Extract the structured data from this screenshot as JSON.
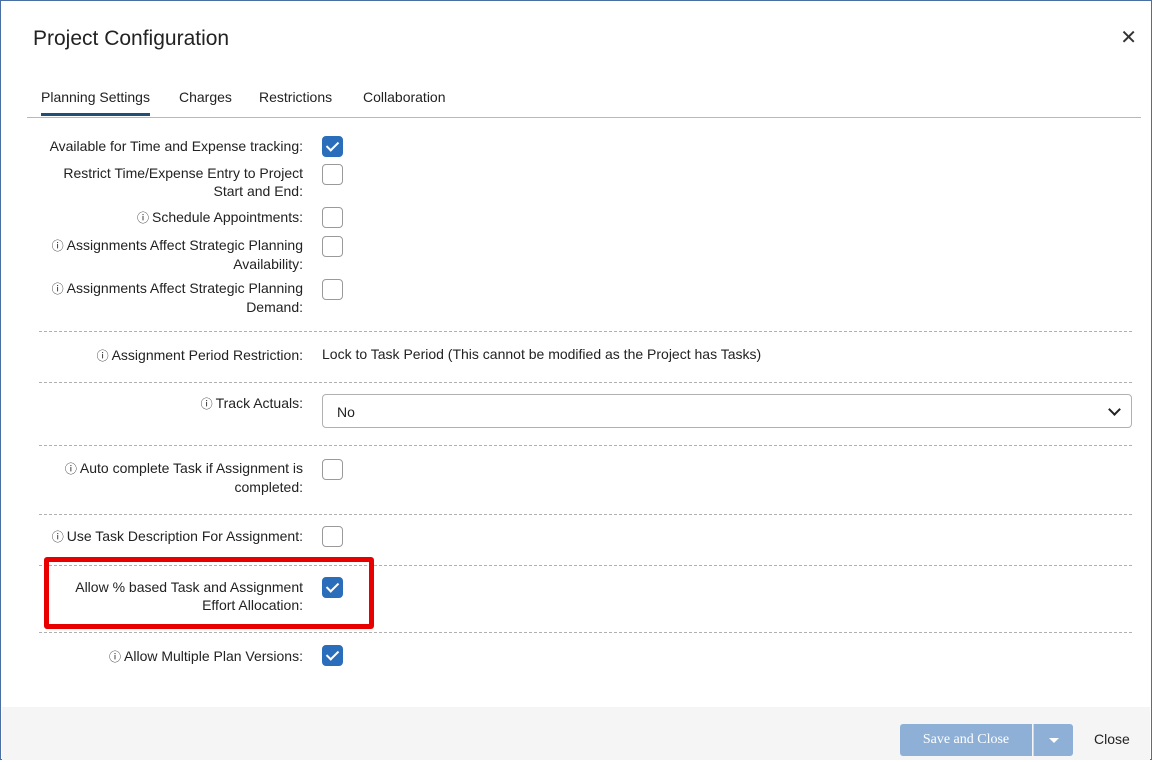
{
  "dialog": {
    "title": "Project Configuration",
    "close_glyph": "✕"
  },
  "tabs": [
    {
      "label": "Planning Settings",
      "active": true
    },
    {
      "label": "Charges",
      "active": false
    },
    {
      "label": "Restrictions",
      "active": false
    },
    {
      "label": "Collaboration",
      "active": false
    }
  ],
  "settings": {
    "time_expense": {
      "label": "Available for Time and Expense tracking:",
      "checked": true
    },
    "restrict_entry": {
      "label_line1": "Restrict Time/Expense Entry to Project",
      "label_line2": "Start and End:",
      "checked": false
    },
    "schedule_appts": {
      "label": "Schedule Appointments:",
      "checked": false
    },
    "assign_avail": {
      "label_line1": "Assignments Affect Strategic Planning",
      "label_line2": "Availability:",
      "checked": false
    },
    "assign_demand": {
      "label_line1": "Assignments Affect Strategic Planning",
      "label_line2": "Demand:",
      "checked": false
    },
    "period_restriction": {
      "label": "Assignment Period Restriction:",
      "value": "Lock to Task Period (This cannot be modified as the Project has Tasks)"
    },
    "track_actuals": {
      "label": "Track Actuals:",
      "value": "No"
    },
    "auto_complete": {
      "label_line1": "Auto complete Task if Assignment is",
      "label_line2": "completed:",
      "checked": false
    },
    "use_task_desc": {
      "label": "Use Task Description For Assignment:",
      "checked": false
    },
    "pct_effort": {
      "label_line1": "Allow % based Task and Assignment",
      "label_line2": "Effort Allocation:",
      "checked": true
    },
    "multi_plan": {
      "label": "Allow Multiple Plan Versions:",
      "checked": true
    }
  },
  "icons": {
    "info": "ⓘ"
  },
  "footer": {
    "save_label": "Save and Close",
    "close_label": "Close"
  },
  "colors": {
    "accent": "#2a6ebb",
    "highlight": "#e80000",
    "save_button": "#8fb0d6"
  }
}
